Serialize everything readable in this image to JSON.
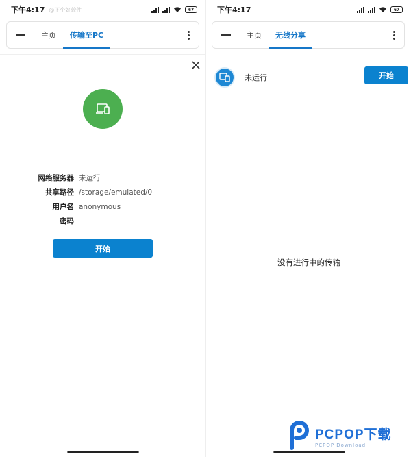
{
  "left": {
    "status": {
      "time": "下午4:17",
      "watermark": "@下个好软件",
      "battery": "67"
    },
    "appbar": {
      "tabs": [
        {
          "label": "主页",
          "active": false
        },
        {
          "label": "传输至PC",
          "active": true
        }
      ]
    },
    "icon": "laptop-phone-icon",
    "info": [
      {
        "key": "网络服务器",
        "value": "未运行"
      },
      {
        "key": "共享路径",
        "value": "/storage/emulated/0"
      },
      {
        "key": "用户名",
        "value": "anonymous"
      },
      {
        "key": "密码",
        "value": ""
      }
    ],
    "start_button": "开始",
    "colors": {
      "accent": "#0b82cf",
      "green": "#4caf50"
    }
  },
  "right": {
    "status": {
      "time": "下午4:17",
      "battery": "67"
    },
    "appbar": {
      "tabs": [
        {
          "label": "主页",
          "active": false
        },
        {
          "label": "无线分享",
          "active": true
        }
      ]
    },
    "card": {
      "status": "未运行",
      "button": "开始"
    },
    "empty_message": "没有进行中的传输"
  },
  "logo": {
    "main": "PCPOP下载",
    "sub": "PCPOP Download"
  }
}
